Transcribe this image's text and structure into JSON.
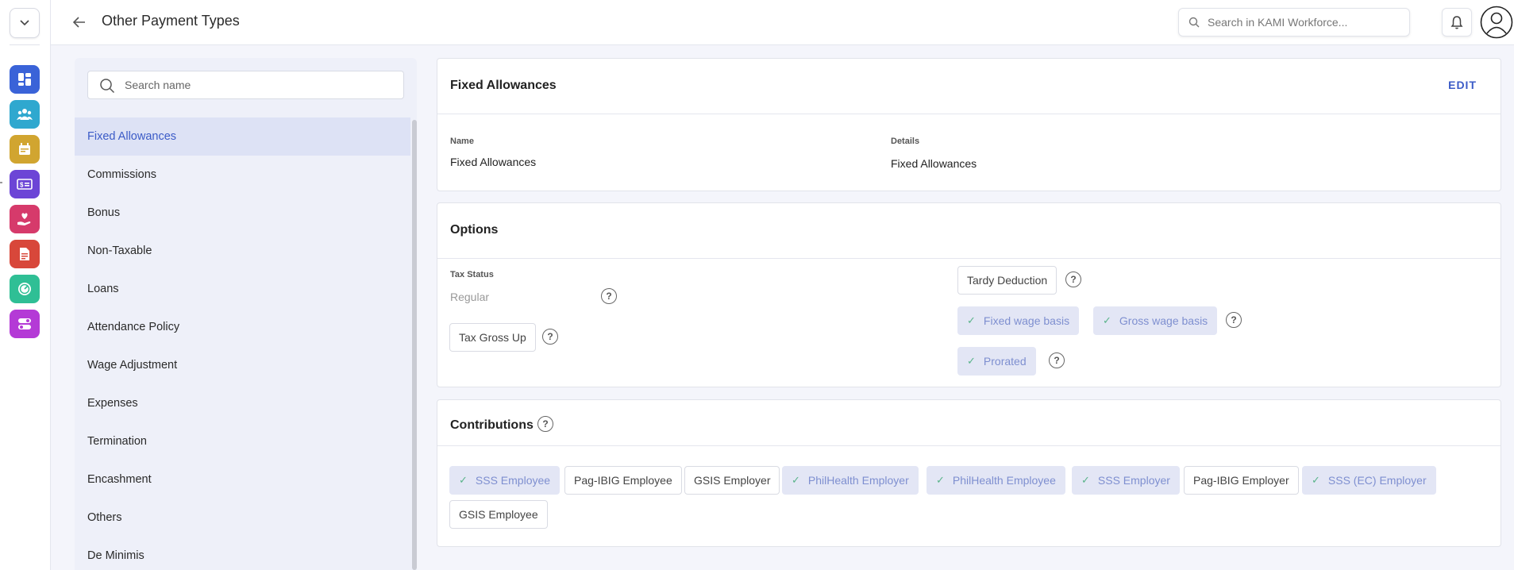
{
  "header": {
    "title": "Other Payment Types",
    "search_placeholder": "Search in KAMI Workforce..."
  },
  "rail": {
    "apps": [
      {
        "name": "dashboard-app",
        "color": "#3a63d8"
      },
      {
        "name": "people-app",
        "color": "#2fa8cf"
      },
      {
        "name": "calendar-app",
        "color": "#d1a530"
      },
      {
        "name": "payroll-app",
        "color": "#6c45d6"
      },
      {
        "name": "benefits-app",
        "color": "#d63a6b"
      },
      {
        "name": "documents-app",
        "color": "#d8473a"
      },
      {
        "name": "performance-app",
        "color": "#2fbf95"
      },
      {
        "name": "settings-app",
        "color": "#b43ad6"
      }
    ]
  },
  "list": {
    "search_placeholder": "Search name",
    "items": [
      "Fixed Allowances",
      "Commissions",
      "Bonus",
      "Non-Taxable",
      "Loans",
      "Attendance Policy",
      "Wage Adjustment",
      "Expenses",
      "Termination",
      "Encashment",
      "Others",
      "De Minimis"
    ],
    "active_index": 0
  },
  "detail": {
    "title": "Fixed Allowances",
    "edit_label": "EDIT",
    "name_label": "Name",
    "name_value": "Fixed Allowances",
    "details_label": "Details",
    "details_value": "Fixed Allowances"
  },
  "options": {
    "title": "Options",
    "tax_status_label": "Tax Status",
    "tax_status_value": "Regular",
    "tax_gross_up": {
      "label": "Tax Gross Up",
      "checked": false
    },
    "tardy_deduction": {
      "label": "Tardy Deduction",
      "checked": false
    },
    "fixed_wage_basis": {
      "label": "Fixed wage basis",
      "checked": true
    },
    "gross_wage_basis": {
      "label": "Gross wage basis",
      "checked": true
    },
    "prorated": {
      "label": "Prorated",
      "checked": true
    },
    "help_glyph": "?"
  },
  "contributions": {
    "title": "Contributions",
    "check_glyph": "✓",
    "items": [
      {
        "label": "SSS Employee",
        "checked": true
      },
      {
        "label": "Pag-IBIG Employee",
        "checked": false
      },
      {
        "label": "GSIS Employer",
        "checked": false
      },
      {
        "label": "PhilHealth Employer",
        "checked": true
      },
      {
        "label": "PhilHealth Employee",
        "checked": true
      },
      {
        "label": "SSS Employer",
        "checked": true
      },
      {
        "label": "Pag-IBIG Employer",
        "checked": false
      },
      {
        "label": "SSS (EC) Employer",
        "checked": true
      },
      {
        "label": "GSIS Employee",
        "checked": false
      }
    ]
  }
}
